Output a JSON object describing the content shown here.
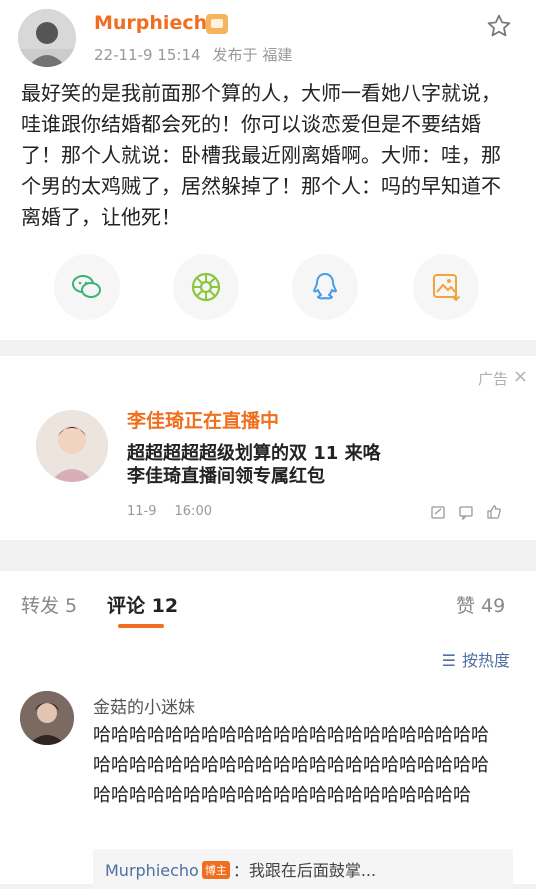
{
  "post": {
    "username": "Murphiecho",
    "date": "22-11-9 15:14",
    "source": "发布于 福建",
    "content": "最好笑的是我前面那个算的人，大师一看她八字就说，哇谁跟你结婚都会死的！你可以谈恋爱但是不要结婚了！那个人就说：卧槽我最近刚离婚啊。大师：哇，那个男的太鸡贼了，居然躲掉了！那个人：吗的早知道不离婚了，让他死！"
  },
  "share": {
    "icons": [
      "wechat-icon",
      "moments-icon",
      "qq-icon",
      "save-image-icon"
    ]
  },
  "ad": {
    "label": "广告",
    "close": "×",
    "title": "李佳琦正在直播中",
    "line1": "超超超超超级划算的双 11 来咯",
    "line2": "李佳琦直播间领专属红包",
    "date": "11-9",
    "time": "16:00"
  },
  "tabs": {
    "repost": "转发 5",
    "comments": "评论 12",
    "likes": "赞 49"
  },
  "comments": {
    "sort_label": "按热度",
    "sort_icon": "☰",
    "items": [
      {
        "name": "金菇的小迷妹",
        "text": "哈哈哈哈哈哈哈哈哈哈哈哈哈哈哈哈哈哈哈哈哈哈哈哈哈哈哈哈哈哈哈哈哈哈哈哈哈哈哈哈哈哈哈哈哈哈哈哈哈哈哈哈哈哈哈哈哈哈哈哈哈哈哈哈哈"
      }
    ],
    "reply": {
      "user": "Murphiecho",
      "badge": "博主",
      "text": "：我跟在后面鼓掌..."
    }
  },
  "colors": {
    "accent": "#f06e1f",
    "link": "#4f6fa5",
    "wechat": "#3cb371",
    "qq": "#4a9be8",
    "save": "#f2a43c"
  }
}
